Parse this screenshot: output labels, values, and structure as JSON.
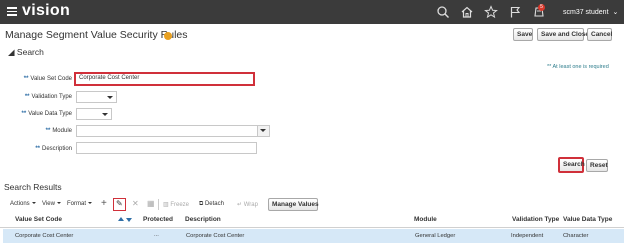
{
  "header": {
    "logo": "vision",
    "notification_count": "5",
    "user_label": "scm37 student"
  },
  "page": {
    "title": "Manage Segment Value Security Rules",
    "buttons": {
      "save": "Save",
      "save_close": "Save and Close",
      "cancel": "Cancel"
    }
  },
  "search": {
    "section_title": "Search",
    "required_note": "** At least one is required",
    "req_marker": "**",
    "fields": {
      "value_set_code": {
        "label": "Value Set Code",
        "value": "Corporate Cost Center"
      },
      "validation_type": {
        "label": "Validation Type",
        "value": ""
      },
      "value_data_type": {
        "label": "Value Data Type",
        "value": ""
      },
      "module": {
        "label": "Module",
        "value": ""
      },
      "description": {
        "label": "Description",
        "value": ""
      }
    },
    "search_button": "Search",
    "reset_button": "Reset"
  },
  "results": {
    "title": "Search Results",
    "toolbar": {
      "actions": "Actions",
      "view": "View",
      "format": "Format",
      "freeze": "Freeze",
      "detach": "Detach",
      "wrap": "Wrap",
      "manage_values": "Manage Values"
    },
    "columns": {
      "value_set_code": "Value Set Code",
      "protected": "Protected",
      "description": "Description",
      "module": "Module",
      "validation_type": "Validation Type",
      "value_data_type": "Value Data Type"
    },
    "rows": [
      {
        "value_set_code": "Corporate Cost Center",
        "protected": "...",
        "description": "Corporate Cost Center",
        "module": "General Ledger",
        "validation_type": "Independent",
        "value_data_type": "Character"
      }
    ]
  },
  "colors": {
    "topbar": "#3b3b3b",
    "highlight": "#d0303a",
    "selected_row": "#d6e8f7",
    "required_star": "#2e6ea6"
  }
}
